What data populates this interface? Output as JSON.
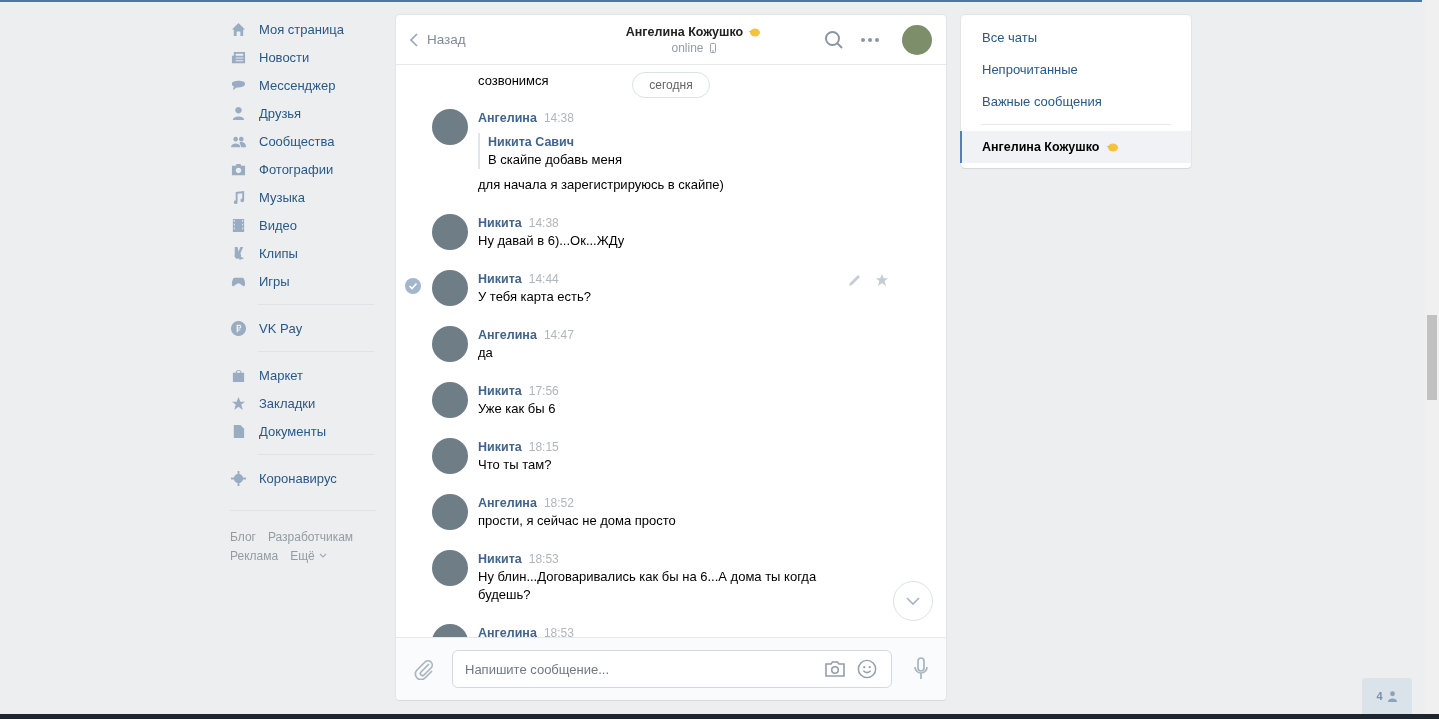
{
  "nav": {
    "groups": [
      {
        "items": [
          "Моя страница",
          "Новости",
          "Мессенджер",
          "Друзья",
          "Сообщества",
          "Фотографии",
          "Музыка",
          "Видео",
          "Клипы",
          "Игры"
        ]
      },
      {
        "items": [
          "VK Pay"
        ]
      },
      {
        "items": [
          "Маркет",
          "Закладки",
          "Документы"
        ]
      },
      {
        "items": [
          "Коронавирус"
        ]
      }
    ],
    "footer": [
      [
        "Блог",
        "Разработчикам"
      ],
      [
        "Реклама",
        "Ещё"
      ]
    ]
  },
  "chat": {
    "back": "Назад",
    "title": "Ангелина Кожушко",
    "status": "online",
    "date_pill": "сегодня",
    "messages": [
      {
        "kind": "continued",
        "text": "созвонимся",
        "selected": false
      },
      {
        "kind": "quote",
        "sender": "Ангелина",
        "time": "14:38",
        "quote_author": "Никита Савич",
        "quote_text": "В скайпе добавь меня",
        "text": "для начала я зарегистрируюсь в скайпе)",
        "selected": false
      },
      {
        "kind": "plain",
        "sender": "Никита",
        "time": "14:38",
        "text": "Ну давай в 6)...Ок...ЖДу",
        "selected": false
      },
      {
        "kind": "plain",
        "sender": "Никита",
        "time": "14:44",
        "text": "У тебя карта есть?",
        "selected": true
      },
      {
        "kind": "plain",
        "sender": "Ангелина",
        "time": "14:47",
        "text": "да",
        "selected": false
      },
      {
        "kind": "plain",
        "sender": "Никита",
        "time": "17:56",
        "text": "Уже как бы 6",
        "selected": false
      },
      {
        "kind": "plain",
        "sender": "Никита",
        "time": "18:15",
        "text": "Что ты там?",
        "selected": false
      },
      {
        "kind": "plain",
        "sender": "Ангелина",
        "time": "18:52",
        "text": "прости, я сейчас не дома просто",
        "selected": false
      },
      {
        "kind": "plain",
        "sender": "Никита",
        "time": "18:53",
        "text": "Ну блин...Договаривались как бы на 6...А дома ты когда будешь?",
        "selected": false
      },
      {
        "kind": "plain",
        "sender": "Ангелина",
        "time": "18:53",
        "selected": false
      }
    ],
    "composer": {
      "placeholder": "Напишите сообщение..."
    }
  },
  "filters": [
    {
      "label": "Все чаты",
      "selected": false
    },
    {
      "label": "Непрочитанные",
      "selected": false
    },
    {
      "label": "Важные сообщения",
      "selected": false
    }
  ],
  "chats": [
    {
      "label": "Ангелина Кожушко",
      "selected": true
    }
  ],
  "online_badge": "4"
}
